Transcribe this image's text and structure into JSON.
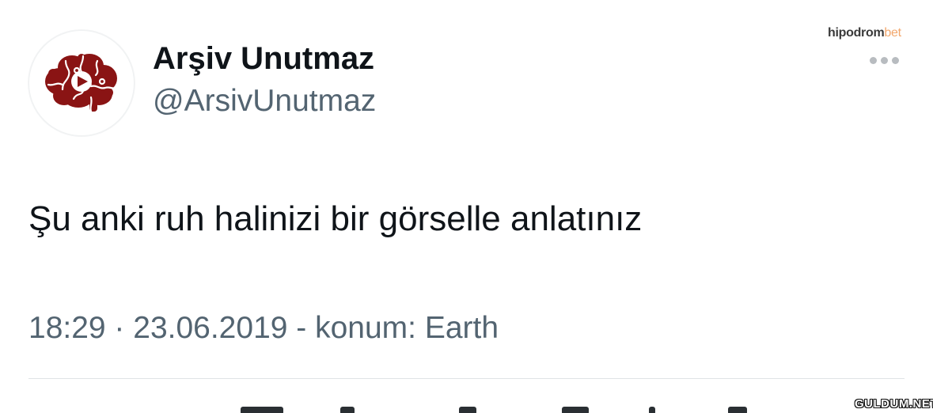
{
  "tweet": {
    "display_name": "Arşiv Unutmaz",
    "handle": "@ArsivUnutmaz",
    "avatar_icon": "brain-puzzle-play-icon",
    "text": "Şu anki ruh halinizi bir görselle anlatınız",
    "timestamp": "18:29 · 23.06.2019 - konum: Earth",
    "more_icon": "more-horizontal-icon"
  },
  "watermarks": {
    "brand_main": "hipodrom",
    "brand_accent": "bet",
    "site": "GULDUM.NET"
  },
  "colors": {
    "text_primary": "#0f1419",
    "text_secondary": "#536471",
    "avatar_brain": "#8a1414",
    "brand_accent": "#f2a76c",
    "divider": "#dfe3e6"
  }
}
